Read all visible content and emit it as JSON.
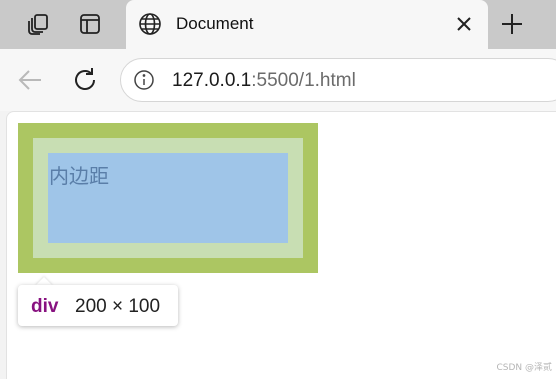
{
  "browser": {
    "tab": {
      "title": "Document",
      "favicon": "globe-icon",
      "close_icon": "close-icon"
    },
    "strip_icons": [
      "workspaces-icon",
      "tab-actions-icon"
    ],
    "new_tab_icon": "plus-icon",
    "toolbar": {
      "back_icon": "back-arrow-icon",
      "reload_icon": "reload-icon",
      "site_info_icon": "info-icon",
      "url_host": "127.0.0.1",
      "url_rest": ":5500/1.html"
    }
  },
  "page": {
    "div_text": "内边距"
  },
  "inspector_tooltip": {
    "tag": "div",
    "dimensions": "200 × 100"
  },
  "box_model_colors": {
    "margin": "#acc662",
    "padding": "#c8deb3",
    "content": "#9fc5e8"
  },
  "watermark": "CSDN @泽贰"
}
